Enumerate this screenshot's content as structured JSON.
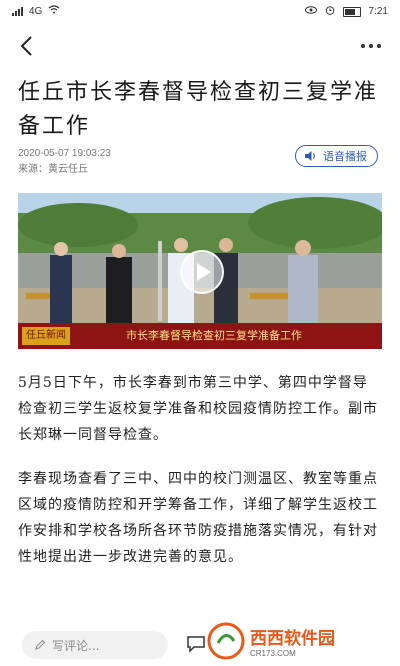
{
  "status": {
    "network": "4G",
    "time": "7:21"
  },
  "nav": {
    "back": "back",
    "more": "more"
  },
  "article": {
    "title": "任丘市长李春督导检查初三复学准备工作",
    "date": "2020-05-07 19:03:23",
    "source": "来源：黄云任丘",
    "voice_label": "语音播报",
    "video": {
      "caption": "市长李春督导检查初三复学准备工作",
      "logo_text": "任丘新闻"
    },
    "paragraphs": [
      "5月5日下午，市长李春到市第三中学、第四中学督导检查初三学生返校复学准备和校园疫情防控工作。副市长郑琳一同督导检查。",
      "李春现场查看了三中、四中的校门测温区、教室等重点区域的疫情防控和开学筹备工作，详细了解学生返校工作安排和学校各场所各环节防疫措施落实情况，有针对性地提出进一步改进完善的意见。"
    ]
  },
  "bottom": {
    "comment_placeholder": "写评论..."
  },
  "watermark": {
    "brand": "西西软件园",
    "url": "CR173.COM"
  },
  "icons": [
    "back-arrow-icon",
    "more-icon",
    "speaker-icon",
    "play-icon",
    "pencil-icon",
    "comment-icon"
  ]
}
